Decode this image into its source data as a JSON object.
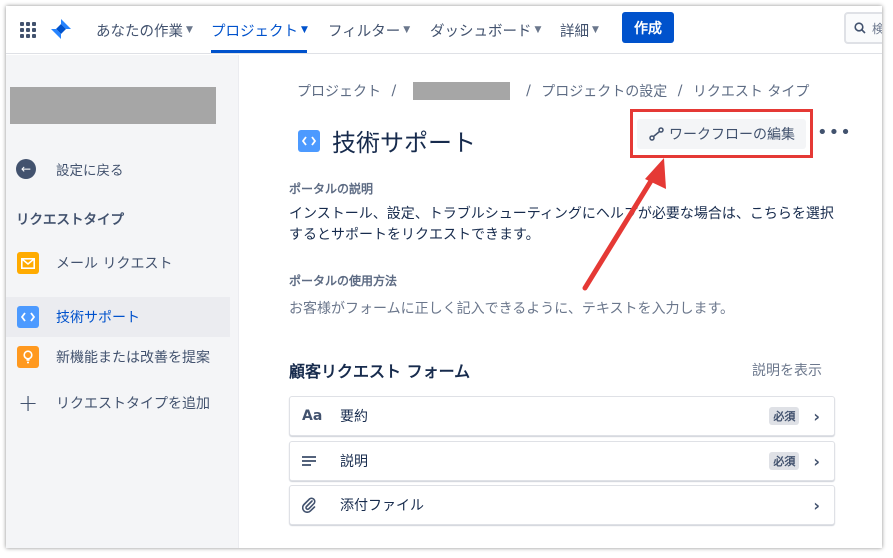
{
  "topnav": {
    "items": [
      {
        "label": "あなたの作業",
        "active": false
      },
      {
        "label": "プロジェクト",
        "active": true
      },
      {
        "label": "フィルター",
        "active": false
      },
      {
        "label": "ダッシュボード",
        "active": false
      },
      {
        "label": "詳細",
        "active": false
      }
    ],
    "create_label": "作成",
    "search_placeholder": "検"
  },
  "sidebar": {
    "back_label": "設定に戻る",
    "section_title": "リクエストタイプ",
    "items": [
      {
        "label": "メール リクエスト",
        "icon": "mail-icon",
        "selected": false
      },
      {
        "label": "技術サポート",
        "icon": "code-icon",
        "selected": true
      },
      {
        "label": "新機能または改善を提案",
        "icon": "lightbulb-icon",
        "selected": false
      },
      {
        "label": "リクエストタイプを追加",
        "icon": "plus-icon",
        "selected": false
      }
    ]
  },
  "breadcrumb": {
    "items": [
      "プロジェクト",
      "プロジェクトの設定",
      "リクエスト タイプ"
    ],
    "separator": "/"
  },
  "page": {
    "title": "技術サポート",
    "workflow_button": "ワークフローの編集",
    "more_label": "•••",
    "portal_desc_label": "ポータルの説明",
    "portal_desc": "インストール、設定、トラブルシューティングにヘルプが必要な場合は、こちらを選択するとサポートをリクエストできます。",
    "portal_usage_label": "ポータルの使用方法",
    "portal_usage": "お客様がフォームに正しく記入できるように、テキストを入力します。"
  },
  "form": {
    "title": "顧客リクエスト フォーム",
    "show_desc": "説明を表示",
    "fields": [
      {
        "label": "要約",
        "icon": "Aa",
        "required": "必須"
      },
      {
        "label": "説明",
        "icon": "≡",
        "required": "必須"
      },
      {
        "label": "添付ファイル",
        "icon": "paperclip",
        "required": ""
      }
    ]
  },
  "colors": {
    "accent": "#0052cc",
    "highlight": "#e53935",
    "sidebar_bg": "#f4f5f7"
  }
}
